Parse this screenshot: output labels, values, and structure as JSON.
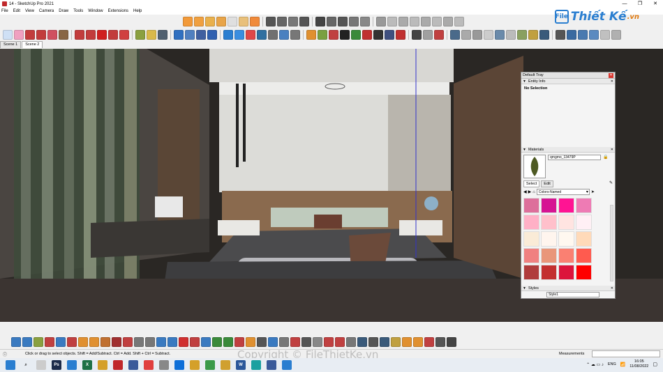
{
  "window": {
    "title": "14 - SketchUp Pro 2021",
    "controls": [
      "—",
      "❐",
      "✕"
    ]
  },
  "menu": [
    "File",
    "Edit",
    "View",
    "Camera",
    "Draw",
    "Tools",
    "Window",
    "Extensions",
    "Help"
  ],
  "scenes": [
    {
      "label": "Scene 1"
    },
    {
      "label": "Scene 2"
    }
  ],
  "logo": {
    "box": "File",
    "text": "Thiết Kế",
    "suffix": ".vn"
  },
  "tray": {
    "title": "Default Tray",
    "entity_info": {
      "header": "Entity Info",
      "content": "No Selection"
    },
    "materials": {
      "header": "Materials",
      "name": "qmgmo_13479P",
      "tabs": [
        "Select",
        "Edit"
      ],
      "collection": "Colors-Named",
      "swatches": [
        "#dd6f9b",
        "#d61493",
        "#ff1493",
        "#ee7bb4",
        "#ffb0c6",
        "#ffc0cb",
        "#ffe4e1",
        "#fff0f5",
        "#faebd7",
        "#fff5ee",
        "#fff8f0",
        "#ffdab9",
        "#f08080",
        "#e9967a",
        "#fa8072",
        "#ff5b4f",
        "#b03c3c",
        "#c32f2f",
        "#dc143c",
        "#ff0000"
      ]
    },
    "styles": {
      "header": "Styles",
      "name": "Style1"
    }
  },
  "status": {
    "hint": "Click or drag to select objects. Shift = Add/Subtract. Ctrl = Add. Shift + Ctrl = Subtract.",
    "measurements_label": "Measurements"
  },
  "taskbar": {
    "lang": "ENG",
    "time": "16:05",
    "date": "11/08/2022"
  },
  "watermark": "Copyright © FileThietKe.vn",
  "colors": {
    "viewport_bg": "#2b2925",
    "logo": "#2a7ed0",
    "accent": "#ff1493"
  }
}
